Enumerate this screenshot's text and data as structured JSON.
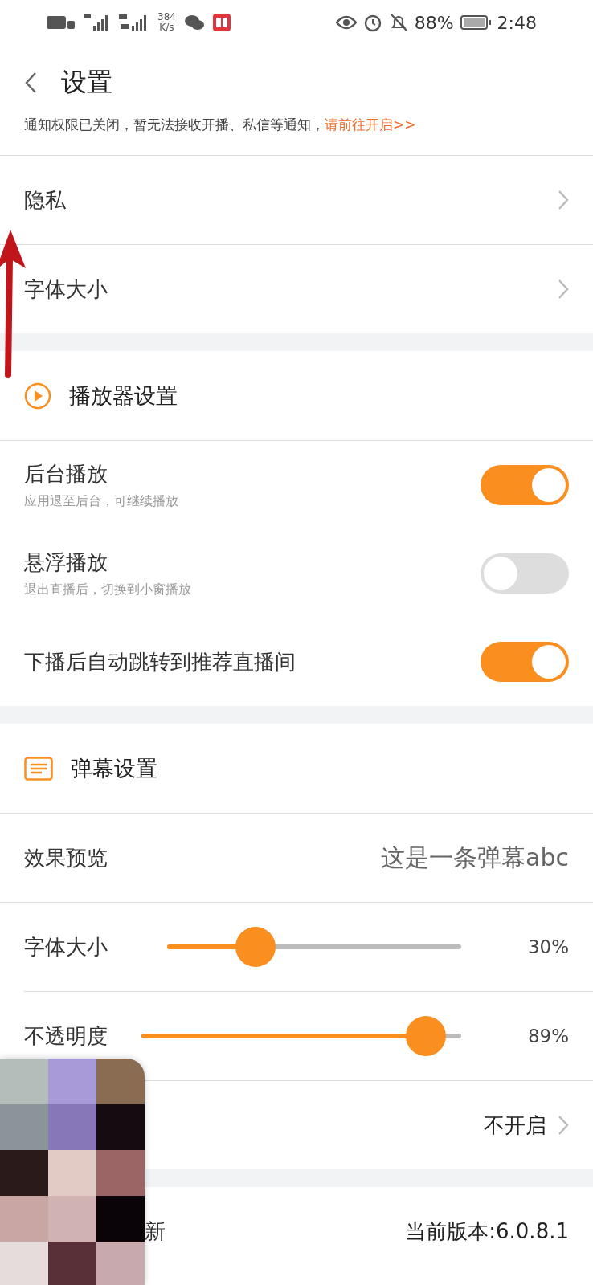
{
  "status_bar": {
    "network_speed": "384",
    "network_unit": "K/s",
    "battery": "88%",
    "time": "2:48"
  },
  "header": {
    "title": "设置",
    "notice": "通知权限已关闭，暂无法接收开播、私信等通知，",
    "notice_link": "请前往开启>>"
  },
  "sections": [
    {
      "items": [
        {
          "kind": "nav",
          "label": "隐私"
        },
        {
          "kind": "nav",
          "label": "字体大小"
        }
      ]
    },
    {
      "title": "播放器设置",
      "items": [
        {
          "kind": "toggle",
          "label": "后台播放",
          "subtitle": "应用退至后台，可继续播放",
          "on": true
        },
        {
          "kind": "toggle",
          "label": "悬浮播放",
          "subtitle": "退出直播后，切换到小窗播放",
          "on": false
        },
        {
          "kind": "toggle",
          "label": "下播后自动跳转到推荐直播间",
          "on": true
        }
      ]
    },
    {
      "title": "弹幕设置",
      "items": [
        {
          "kind": "preview",
          "label": "效果预览",
          "value": "这是一条弹幕abc"
        },
        {
          "kind": "slider",
          "label": "字体大小",
          "level": 0.3,
          "reading": "30%"
        },
        {
          "kind": "slider",
          "label": "不透明度",
          "level": 0.89,
          "reading": "89%"
        },
        {
          "kind": "nav",
          "value": "不开启"
        }
      ]
    },
    {
      "items": [
        {
          "kind": "value",
          "label": "新",
          "value": "当前版本:6.0.8.1"
        }
      ]
    }
  ]
}
